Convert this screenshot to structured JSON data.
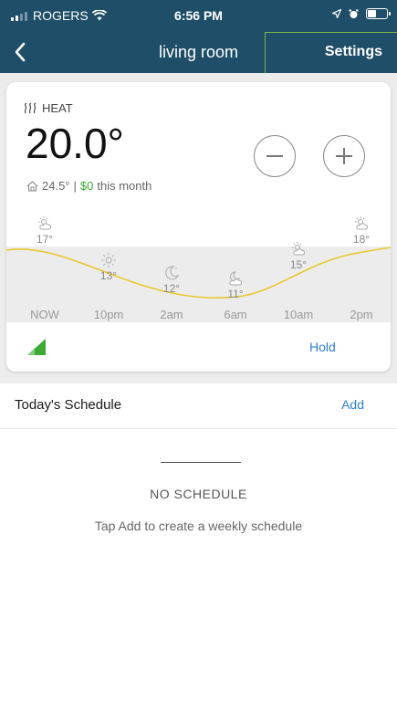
{
  "status_bar": {
    "carrier": "ROGERS",
    "time": "6:56 PM",
    "battery_level": 0.45,
    "icons": [
      "signal-icon",
      "wifi-icon",
      "location-icon",
      "alarm-icon",
      "battery-icon"
    ]
  },
  "nav": {
    "back_icon": "chevron-left-icon",
    "title": "living room",
    "settings_label": "Settings",
    "highlight_color": "#7ab648"
  },
  "thermostat": {
    "mode_icon": "heat-icon",
    "mode_label": "HEAT",
    "setpoint": "20.0°",
    "indoor_icon": "home-icon",
    "indoor_temp": "24.5°",
    "separator": "|",
    "cost_amount": "$0",
    "cost_suffix": "this month",
    "decrease_icon": "minus-icon",
    "increase_icon": "plus-icon"
  },
  "forecast": [
    {
      "icon": "sun-cloud-icon",
      "temp": "17°",
      "time": "NOW"
    },
    {
      "icon": "sun-icon",
      "temp": "13°",
      "time": "10pm"
    },
    {
      "icon": "moon-icon",
      "temp": "12°",
      "time": "2am"
    },
    {
      "icon": "moon-cloud-icon",
      "temp": "11°",
      "time": "6am"
    },
    {
      "icon": "sun-cloud-icon",
      "temp": "15°",
      "time": "10am"
    },
    {
      "icon": "sun-cloud-icon",
      "temp": "18°",
      "time": "2pm"
    }
  ],
  "controls": {
    "signal_icon": "signal-strength-icon",
    "hold_label": "Hold"
  },
  "schedule": {
    "title": "Today's Schedule",
    "add_label": "Add",
    "empty_title": "NO SCHEDULE",
    "empty_hint": "Tap Add to create a weekly schedule"
  },
  "colors": {
    "header": "#1f4e68",
    "accent_blue": "#2d7dd2",
    "money_green": "#3aaa35",
    "curve_yellow": "#e8c82e"
  }
}
